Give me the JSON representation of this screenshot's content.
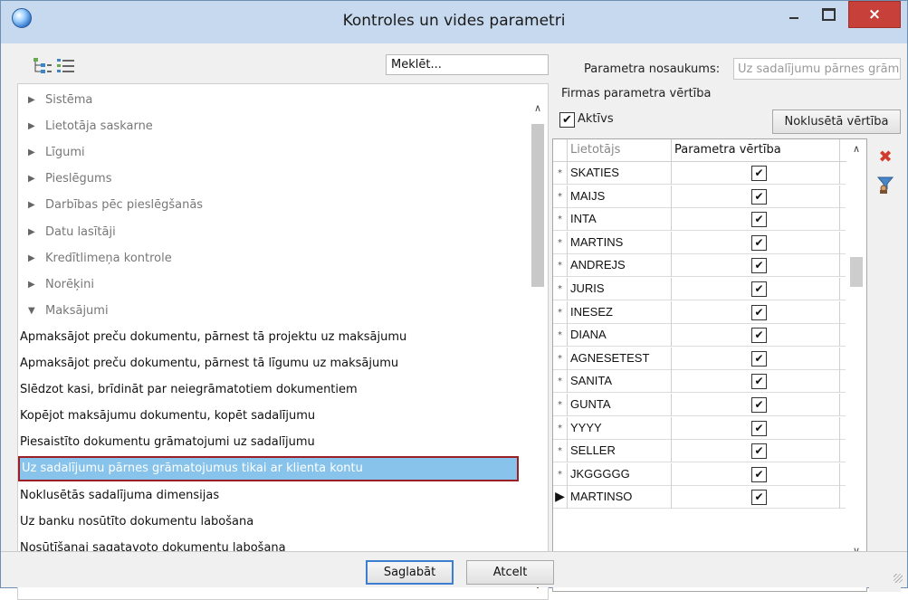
{
  "window": {
    "title": "Kontroles un vides parametri",
    "close_glyph": "×"
  },
  "left": {
    "search": {
      "value": "Meklēt..."
    },
    "tree": [
      {
        "label": "Sistēma",
        "type": "group",
        "expanded": false
      },
      {
        "label": "Lietotāja saskarne",
        "type": "group",
        "expanded": false
      },
      {
        "label": "Līgumi",
        "type": "group",
        "expanded": false
      },
      {
        "label": "Pieslēgums",
        "type": "group",
        "expanded": false
      },
      {
        "label": "Darbības pēc pieslēgšanās",
        "type": "group",
        "expanded": false
      },
      {
        "label": "Datu lasītāji",
        "type": "group",
        "expanded": false
      },
      {
        "label": "Kredītlimeņa kontrole",
        "type": "group",
        "expanded": false
      },
      {
        "label": "Norēķini",
        "type": "group",
        "expanded": false
      },
      {
        "label": "Maksājumi",
        "type": "group",
        "expanded": true
      },
      {
        "label": "Apmaksājot preču dokumentu, pārnest tā projektu uz maksājumu",
        "type": "leaf"
      },
      {
        "label": "Apmaksājot preču dokumentu, pārnest tā līgumu uz maksājumu",
        "type": "leaf"
      },
      {
        "label": "Slēdzot kasi, brīdināt par neiegrāmatotiem dokumentiem",
        "type": "leaf"
      },
      {
        "label": "Kopējot maksājumu dokumentu, kopēt sadalījumu",
        "type": "leaf"
      },
      {
        "label": "Piesaistīto dokumentu grāmatojumi uz sadalījumu",
        "type": "leaf"
      },
      {
        "label": "Uz sadalījumu pārnes grāmatojumus tikai ar klienta kontu",
        "type": "leaf",
        "selected": true
      },
      {
        "label": "Noklusētās sadalījuma dimensijas",
        "type": "leaf"
      },
      {
        "label": "Uz banku nosūtīto dokumentu labošana",
        "type": "leaf"
      },
      {
        "label": "Nosūtīšanai sagatavoto dokumentu labošana",
        "type": "leaf"
      }
    ]
  },
  "right": {
    "param_name_label": "Parametra nosaukums:",
    "param_name_value": "Uz sadalījumu pārnes grāmatojumus tikai ar klienta kontu",
    "company_value_label": "Firmas parametra vērtība",
    "active": {
      "label": "Aktīvs",
      "checked": true
    },
    "default_button": "Noklusētā vērtība",
    "grid": {
      "columns": [
        "Lietotājs",
        "Parametra vērtība"
      ],
      "rows": [
        {
          "user": "SKATIES",
          "checked": true,
          "marker": "*"
        },
        {
          "user": "MAIJS",
          "checked": true,
          "marker": "*"
        },
        {
          "user": "INTA",
          "checked": true,
          "marker": "*"
        },
        {
          "user": "MARTINS",
          "checked": true,
          "marker": "*"
        },
        {
          "user": "ANDREJS",
          "checked": true,
          "marker": "*"
        },
        {
          "user": "JURIS",
          "checked": true,
          "marker": "*"
        },
        {
          "user": "INESEZ",
          "checked": true,
          "marker": "*"
        },
        {
          "user": "DIANA",
          "checked": true,
          "marker": "*"
        },
        {
          "user": "AGNESETEST",
          "checked": true,
          "marker": "*"
        },
        {
          "user": "SANITA",
          "checked": true,
          "marker": "*"
        },
        {
          "user": "GUNTA",
          "checked": true,
          "marker": "*"
        },
        {
          "user": "YYYY",
          "checked": true,
          "marker": "*"
        },
        {
          "user": "SELLER",
          "checked": true,
          "marker": "*"
        },
        {
          "user": "JKGGGGG",
          "checked": true,
          "marker": "*"
        },
        {
          "user": "MARTINSO",
          "checked": true,
          "marker": "▶",
          "current": true
        }
      ]
    },
    "side_tools": [
      {
        "icon": "delete-x-icon",
        "glyph": "✖"
      },
      {
        "icon": "filter-user-icon",
        "glyph": "⏳"
      }
    ]
  },
  "footer": {
    "save": "Saglabāt",
    "cancel": "Atcelt"
  },
  "glyphs": {
    "collapsed": "▶",
    "expanded": "▼",
    "check": "✔",
    "scroll_up": "∧",
    "scroll_down": "∨",
    "scroll_left": "<",
    "scroll_right": ">"
  }
}
